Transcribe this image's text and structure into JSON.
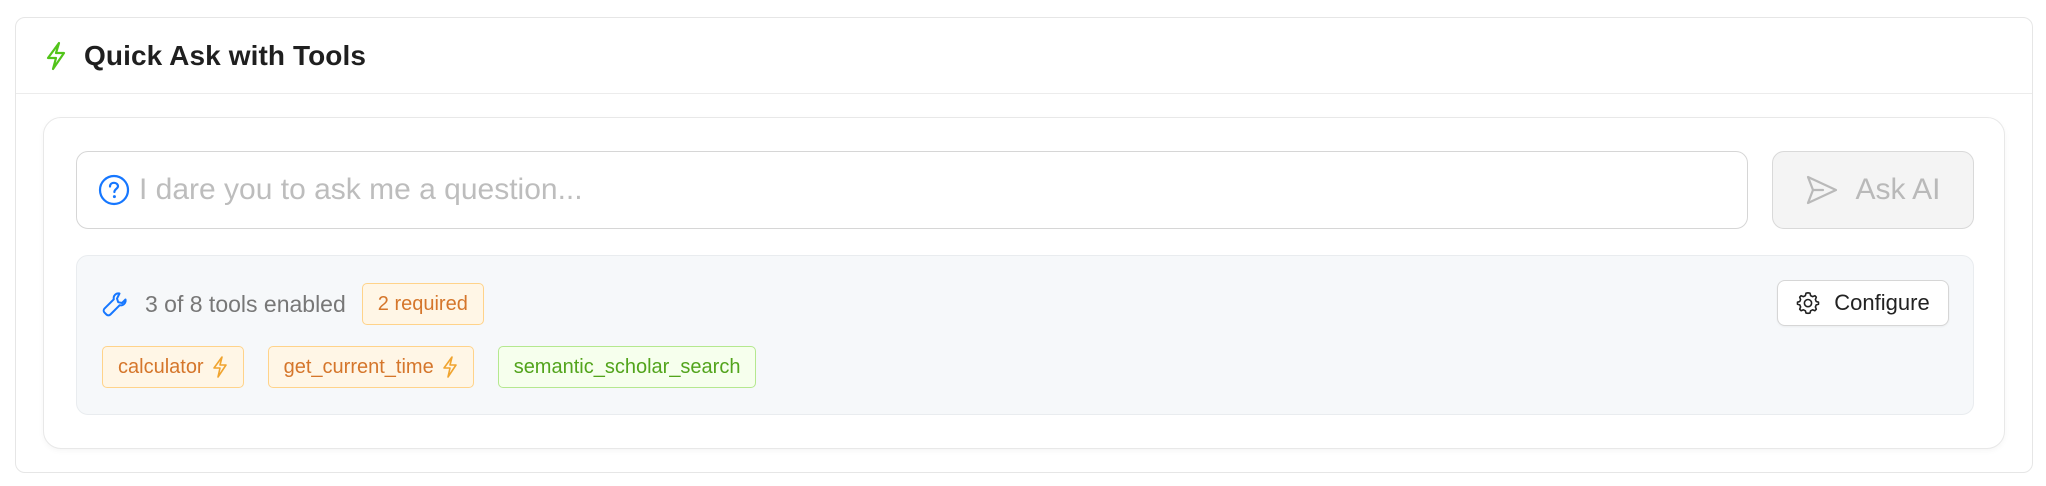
{
  "header": {
    "title": "Quick Ask with Tools",
    "icon": "lightning-icon",
    "icon_color": "#52c41a"
  },
  "question": {
    "placeholder": "I dare you to ask me a question...",
    "value": "",
    "icon": "question-circle-icon",
    "icon_color": "#1677ff"
  },
  "ask_button": {
    "label": "Ask AI",
    "icon": "send-icon",
    "disabled": true
  },
  "tools": {
    "summary": "3 of 8 tools enabled",
    "required_badge": "2 required",
    "configure_label": "Configure",
    "items": [
      {
        "name": "calculator",
        "required": true,
        "color": "orange"
      },
      {
        "name": "get_current_time",
        "required": true,
        "color": "orange"
      },
      {
        "name": "semantic_scholar_search",
        "required": false,
        "color": "green"
      }
    ]
  },
  "colors": {
    "accent_orange": "#d5762b",
    "accent_green": "#52a41c",
    "accent_blue": "#1677ff"
  }
}
